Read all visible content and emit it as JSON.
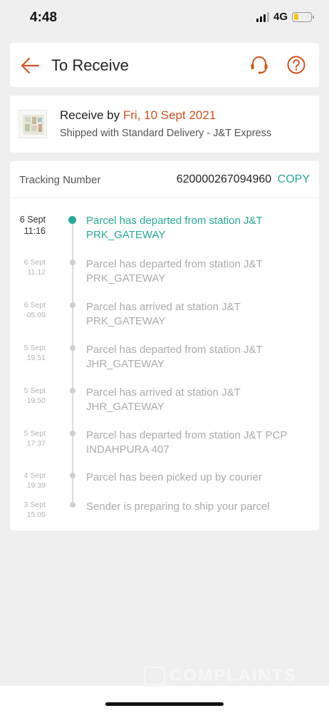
{
  "status_bar": {
    "time": "4:48",
    "network": "4G",
    "battery_level": 0.3,
    "signal_bars": 3
  },
  "header": {
    "title": "To Receive",
    "back_icon": "back-arrow-icon",
    "support_icon": "headset-icon",
    "help_icon": "question-circle-icon",
    "accent_color": "#d0521f"
  },
  "delivery": {
    "receive_prefix": "Receive by",
    "receive_date": "Fri, 10 Sept 2021",
    "shipping_info": "Shipped with Standard Delivery  - J&T Express"
  },
  "tracking": {
    "label": "Tracking Number",
    "number": "620000267094960",
    "copy_label": "COPY",
    "copy_color": "#26aa99",
    "events": [
      {
        "date": "6 Sept",
        "time": "11:16",
        "description": "Parcel has departed from station J&T PRK_GATEWAY",
        "active": true
      },
      {
        "date": "6 Sept",
        "time": "11:12",
        "description": "Parcel has departed from station J&T PRK_GATEWAY",
        "active": false
      },
      {
        "date": "6 Sept",
        "time": "05:09",
        "description": "Parcel has arrived at station J&T PRK_GATEWAY",
        "active": false
      },
      {
        "date": "5 Sept",
        "time": "19:51",
        "description": "Parcel has departed from station J&T JHR_GATEWAY",
        "active": false
      },
      {
        "date": "5 Sept",
        "time": "19:50",
        "description": "Parcel has arrived at station J&T JHR_GATEWAY",
        "active": false
      },
      {
        "date": "5 Sept",
        "time": "17:37",
        "description": "Parcel has departed from station J&T PCP INDAHPURA 407",
        "active": false
      },
      {
        "date": "4 Sept",
        "time": "19:39",
        "description": "Parcel has been picked up by courier",
        "active": false
      },
      {
        "date": "3 Sept",
        "time": "15:05",
        "description": "Sender is preparing to ship your parcel",
        "active": false
      }
    ]
  },
  "watermark": {
    "text": "COMPLAINTS"
  }
}
